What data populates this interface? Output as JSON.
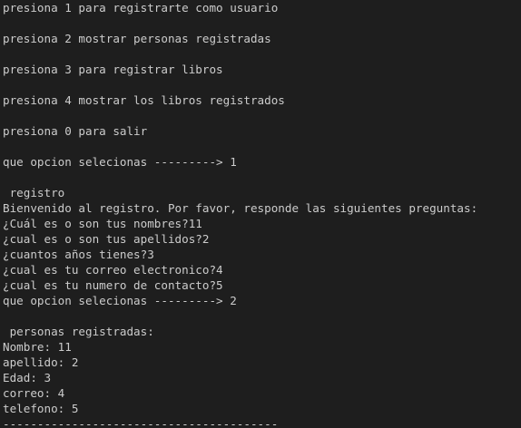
{
  "terminal": {
    "lines": [
      "presiona 1 para registrarte como usuario",
      "",
      "presiona 2 mostrar personas registradas",
      "",
      "presiona 3 para registrar libros",
      "",
      "presiona 4 mostrar los libros registrados",
      "",
      "presiona 0 para salir",
      "",
      "que opcion selecionas ---------> 1",
      "",
      " registro",
      "Bienvenido al registro. Por favor, responde las siguientes preguntas:",
      "¿Cuál es o son tus nombres?11",
      "¿cual es o son tus apellidos?2",
      "¿cuantos años tienes?3",
      "¿cual es tu correo electronico?4",
      "¿cual es tu numero de contacto?5",
      "que opcion selecionas ---------> 2",
      "",
      " personas registradas:",
      "Nombre: 11",
      "apellido: 2",
      "Edad: 3",
      "correo: 4",
      "telefono: 5",
      "----------------------------------------"
    ]
  }
}
